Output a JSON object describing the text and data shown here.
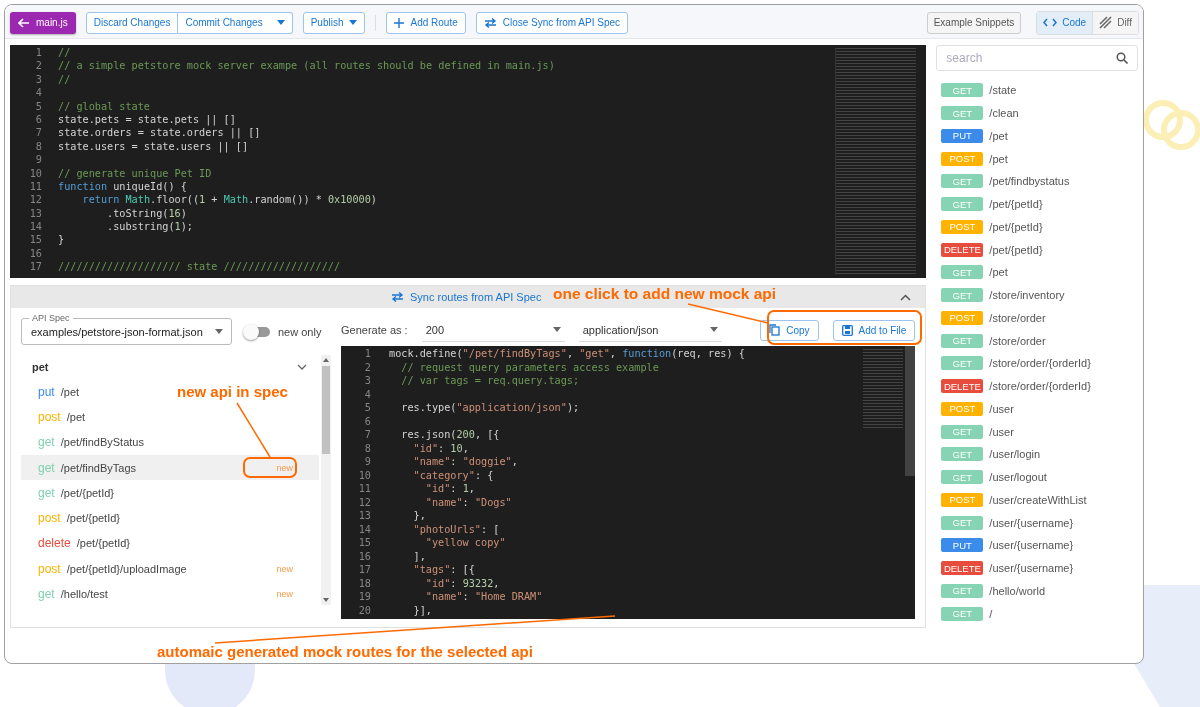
{
  "toolbar": {
    "back_button": "main.js",
    "discard": "Discard Changes",
    "commit": "Commit Changes",
    "publish": "Publish",
    "add_route": "Add Route",
    "close_sync": "Close Sync from API Spec",
    "snippets": "Example Snippets",
    "view_tabs": [
      {
        "label": "Code",
        "selected": true
      },
      {
        "label": "Diff",
        "selected": false
      }
    ]
  },
  "editor": {
    "lines": [
      {
        "number": "1",
        "segments": [
          {
            "kind": "comment",
            "text": "//"
          }
        ]
      },
      {
        "number": "2",
        "segments": [
          {
            "kind": "comment",
            "text": "// a simple petstore mock server exampe (all routes should be defined in main.js)"
          }
        ]
      },
      {
        "number": "3",
        "segments": [
          {
            "kind": "comment",
            "text": "//"
          }
        ]
      },
      {
        "number": "4"
      },
      {
        "number": "5",
        "segments": [
          {
            "kind": "comment",
            "text": "// global state"
          }
        ]
      },
      {
        "number": "6",
        "segments": [
          {
            "kind": "plain",
            "text": "state.pets = state.pets || []"
          }
        ]
      },
      {
        "number": "7",
        "segments": [
          {
            "kind": "plain",
            "text": "state.orders = state.orders || []"
          }
        ]
      },
      {
        "number": "8",
        "segments": [
          {
            "kind": "plain",
            "text": "state.users = state.users || []"
          }
        ]
      },
      {
        "number": "9"
      },
      {
        "number": "10",
        "segments": [
          {
            "kind": "comment",
            "text": "// generate unique Pet ID"
          }
        ]
      },
      {
        "number": "11",
        "segments": [
          {
            "kind": "keyword",
            "text": "function"
          },
          {
            "kind": "plain",
            "text": " uniqueId() {"
          }
        ]
      },
      {
        "number": "12",
        "segments": [
          {
            "kind": "keyword",
            "text": "    return"
          },
          {
            "kind": "builtin",
            "text": " Math"
          },
          {
            "kind": "plain",
            "text": ".floor(("
          },
          {
            "kind": "number",
            "text": "1"
          },
          {
            "kind": "plain",
            "text": " + "
          },
          {
            "kind": "builtin",
            "text": "Math"
          },
          {
            "kind": "plain",
            "text": ".random()) * "
          },
          {
            "kind": "number",
            "text": "0x10000"
          },
          {
            "kind": "plain",
            "text": ")"
          }
        ]
      },
      {
        "number": "13",
        "segments": [
          {
            "kind": "plain",
            "text": "        .toString("
          },
          {
            "kind": "number",
            "text": "16"
          },
          {
            "kind": "plain",
            "text": ")"
          }
        ]
      },
      {
        "number": "14",
        "segments": [
          {
            "kind": "plain",
            "text": "        .substring("
          },
          {
            "kind": "number",
            "text": "1"
          },
          {
            "kind": "plain",
            "text": ");"
          }
        ]
      },
      {
        "number": "15",
        "segments": [
          {
            "kind": "plain",
            "text": "}"
          }
        ]
      },
      {
        "number": "16"
      },
      {
        "number": "17",
        "segments": [
          {
            "kind": "comment",
            "text": "//////////////////// state ///////////////////"
          }
        ]
      }
    ]
  },
  "sync_panel": {
    "title": "Sync routes from API Spec",
    "expanded": true,
    "api_spec": {
      "label": "API Spec",
      "value": "examples/petstore-json-format.json"
    },
    "new_only": {
      "label": "new only",
      "on": false
    },
    "groups": [
      {
        "name": "pet",
        "expanded": true,
        "items": [
          {
            "method": "put",
            "path": "/pet",
            "color": "#3b8beb",
            "selected": false
          },
          {
            "method": "post",
            "path": "/pet",
            "color": "#ffb300",
            "selected": false
          },
          {
            "method": "get",
            "path": "/pet/findByStatus",
            "color": "#7fd1b0",
            "selected": false
          },
          {
            "method": "get",
            "path": "/pet/findByTags",
            "color": "#7fd1b0",
            "badge": "new",
            "selected": true
          },
          {
            "method": "get",
            "path": "/pet/{petId}",
            "color": "#7fd1b0",
            "selected": false
          },
          {
            "method": "post",
            "path": "/pet/{petId}",
            "color": "#ffb300",
            "selected": false
          },
          {
            "method": "delete",
            "path": "/pet/{petId}",
            "color": "#e74c3c",
            "selected": false
          },
          {
            "method": "post",
            "path": "/pet/{petId}/uploadImage",
            "color": "#ffb300",
            "badge": "new",
            "selected": false
          },
          {
            "method": "get",
            "path": "/hello/test",
            "color": "#7fd1b0",
            "badge": "new",
            "selected": false
          }
        ]
      }
    ],
    "generate_label": "Generate as :",
    "status_select": "200",
    "content_type_select": "application/json",
    "copy_button": "Copy",
    "add_button": "Add to File",
    "preview": {
      "lines": [
        {
          "number": "1",
          "segments": [
            {
              "kind": "plain",
              "text": "mock.define("
            },
            {
              "kind": "string",
              "text": "\"/pet/findByTags\""
            },
            {
              "kind": "plain",
              "text": ", "
            },
            {
              "kind": "string",
              "text": "\"get\""
            },
            {
              "kind": "plain",
              "text": ", "
            },
            {
              "kind": "keyword",
              "text": "function"
            },
            {
              "kind": "plain",
              "text": "(req, res) {"
            }
          ]
        },
        {
          "number": "2",
          "segments": [
            {
              "kind": "comment",
              "text": "  // request query parameters access example"
            }
          ]
        },
        {
          "number": "3",
          "segments": [
            {
              "kind": "comment",
              "text": "  // var tags = req.query.tags;"
            }
          ]
        },
        {
          "number": "4"
        },
        {
          "number": "5",
          "segments": [
            {
              "kind": "plain",
              "text": "  res.type("
            },
            {
              "kind": "string",
              "text": "\"application/json\""
            },
            {
              "kind": "plain",
              "text": ");"
            }
          ]
        },
        {
          "number": "6"
        },
        {
          "number": "7",
          "segments": [
            {
              "kind": "plain",
              "text": "  res.json("
            },
            {
              "kind": "number",
              "text": "200"
            },
            {
              "kind": "plain",
              "text": ", [{"
            }
          ]
        },
        {
          "number": "8",
          "segments": [
            {
              "kind": "string",
              "text": "    \"id\""
            },
            {
              "kind": "plain",
              "text": ": "
            },
            {
              "kind": "number",
              "text": "10"
            },
            {
              "kind": "plain",
              "text": ","
            }
          ]
        },
        {
          "number": "9",
          "segments": [
            {
              "kind": "string",
              "text": "    \"name\""
            },
            {
              "kind": "plain",
              "text": ": "
            },
            {
              "kind": "string",
              "text": "\"doggie\""
            },
            {
              "kind": "plain",
              "text": ","
            }
          ]
        },
        {
          "number": "10",
          "segments": [
            {
              "kind": "string",
              "text": "    \"category\""
            },
            {
              "kind": "plain",
              "text": ": {"
            }
          ]
        },
        {
          "number": "11",
          "segments": [
            {
              "kind": "string",
              "text": "      \"id\""
            },
            {
              "kind": "plain",
              "text": ": "
            },
            {
              "kind": "number",
              "text": "1"
            },
            {
              "kind": "plain",
              "text": ","
            }
          ]
        },
        {
          "number": "12",
          "segments": [
            {
              "kind": "string",
              "text": "      \"name\""
            },
            {
              "kind": "plain",
              "text": ": "
            },
            {
              "kind": "string",
              "text": "\"Dogs\""
            }
          ]
        },
        {
          "number": "13",
          "segments": [
            {
              "kind": "plain",
              "text": "    },"
            }
          ]
        },
        {
          "number": "14",
          "segments": [
            {
              "kind": "string",
              "text": "    \"photoUrls\""
            },
            {
              "kind": "plain",
              "text": ": ["
            }
          ]
        },
        {
          "number": "15",
          "segments": [
            {
              "kind": "string",
              "text": "      \"yellow copy\""
            }
          ]
        },
        {
          "number": "16",
          "segments": [
            {
              "kind": "plain",
              "text": "    ],"
            }
          ]
        },
        {
          "number": "17",
          "segments": [
            {
              "kind": "string",
              "text": "    \"tags\""
            },
            {
              "kind": "plain",
              "text": ": [{"
            }
          ]
        },
        {
          "number": "18",
          "segments": [
            {
              "kind": "string",
              "text": "      \"id\""
            },
            {
              "kind": "plain",
              "text": ": "
            },
            {
              "kind": "number",
              "text": "93232"
            },
            {
              "kind": "plain",
              "text": ","
            }
          ]
        },
        {
          "number": "19",
          "segments": [
            {
              "kind": "string",
              "text": "      \"name\""
            },
            {
              "kind": "plain",
              "text": ": "
            },
            {
              "kind": "string",
              "text": "\"Home DRAM\""
            }
          ]
        },
        {
          "number": "20",
          "segments": [
            {
              "kind": "plain",
              "text": "    }],"
            }
          ]
        }
      ]
    }
  },
  "sidebar": {
    "search": {
      "placeholder": "search"
    },
    "routes": [
      {
        "method": "GET",
        "path": "/state",
        "color": "#86d4b4"
      },
      {
        "method": "GET",
        "path": "/clean",
        "color": "#86d4b4"
      },
      {
        "method": "PUT",
        "path": "/pet",
        "color": "#3b8beb"
      },
      {
        "method": "POST",
        "path": "/pet",
        "color": "#ffb300"
      },
      {
        "method": "GET",
        "path": "/pet/findbystatus",
        "color": "#86d4b4"
      },
      {
        "method": "GET",
        "path": "/pet/{petId}",
        "color": "#86d4b4"
      },
      {
        "method": "POST",
        "path": "/pet/{petId}",
        "color": "#ffb300"
      },
      {
        "method": "DELETE",
        "path": "/pet/{petId}",
        "color": "#e74c3c"
      },
      {
        "method": "GET",
        "path": "/pet",
        "color": "#86d4b4"
      },
      {
        "method": "GET",
        "path": "/store/inventory",
        "color": "#86d4b4"
      },
      {
        "method": "POST",
        "path": "/store/order",
        "color": "#ffb300"
      },
      {
        "method": "GET",
        "path": "/store/order",
        "color": "#86d4b4"
      },
      {
        "method": "GET",
        "path": "/store/order/{orderId}",
        "color": "#86d4b4"
      },
      {
        "method": "DELETE",
        "path": "/store/order/{orderId}",
        "color": "#e74c3c"
      },
      {
        "method": "POST",
        "path": "/user",
        "color": "#ffb300"
      },
      {
        "method": "GET",
        "path": "/user",
        "color": "#86d4b4"
      },
      {
        "method": "GET",
        "path": "/user/login",
        "color": "#86d4b4"
      },
      {
        "method": "GET",
        "path": "/user/logout",
        "color": "#86d4b4"
      },
      {
        "method": "POST",
        "path": "/user/createWithList",
        "color": "#ffb300"
      },
      {
        "method": "GET",
        "path": "/user/{username}",
        "color": "#86d4b4"
      },
      {
        "method": "PUT",
        "path": "/user/{username}",
        "color": "#3b8beb"
      },
      {
        "method": "DELETE",
        "path": "/user/{username}",
        "color": "#e74c3c"
      },
      {
        "method": "GET",
        "path": "/hello/world",
        "color": "#86d4b4"
      },
      {
        "method": "GET",
        "path": "/",
        "color": "#86d4b4"
      }
    ]
  },
  "annotations": [
    {
      "kind": "mock-api",
      "text": "one click to add new mock api"
    },
    {
      "kind": "new-api",
      "text": "new api in spec"
    },
    {
      "kind": "generated",
      "text": "automaic generated mock routes for the selected api"
    }
  ]
}
